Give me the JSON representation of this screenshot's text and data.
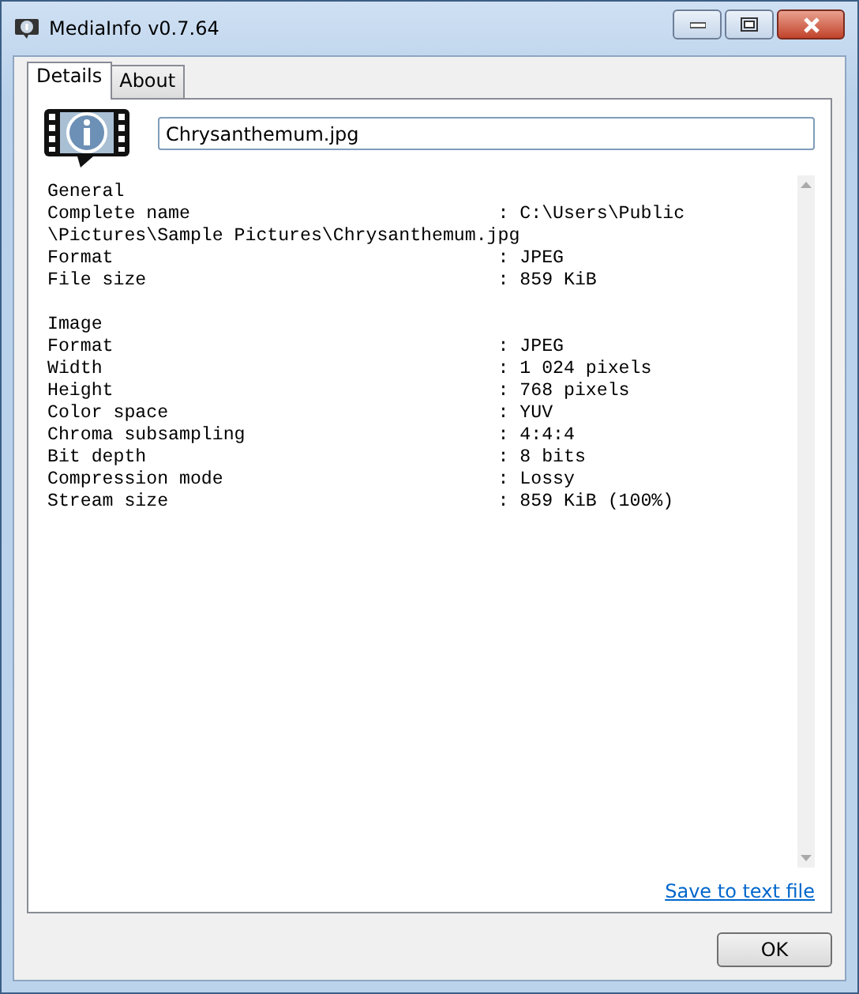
{
  "window": {
    "title": "MediaInfo v0.7.64"
  },
  "tabs": [
    {
      "label": "Details",
      "selected": true
    },
    {
      "label": "About",
      "selected": false
    }
  ],
  "file_field": {
    "value": "Chrysanthemum.jpg"
  },
  "report": {
    "separator": ":",
    "sections": [
      {
        "title": "General",
        "fields": [
          {
            "label": "Complete name",
            "value": "C:\\Users\\Public\\Pictures\\Sample Pictures\\Chrysanthemum.jpg"
          },
          {
            "label": "Format",
            "value": "JPEG"
          },
          {
            "label": "File size",
            "value": "859 KiB"
          }
        ]
      },
      {
        "title": "Image",
        "fields": [
          {
            "label": "Format",
            "value": "JPEG"
          },
          {
            "label": "Width",
            "value": "1 024 pixels"
          },
          {
            "label": "Height",
            "value": "768 pixels"
          },
          {
            "label": "Color space",
            "value": "YUV"
          },
          {
            "label": "Chroma subsampling",
            "value": "4:4:4"
          },
          {
            "label": "Bit depth",
            "value": "8 bits"
          },
          {
            "label": "Compression mode",
            "value": "Lossy"
          },
          {
            "label": "Stream size",
            "value": "859 KiB (100%)"
          }
        ]
      }
    ]
  },
  "save_link": "Save to text file",
  "buttons": [
    "OK"
  ]
}
